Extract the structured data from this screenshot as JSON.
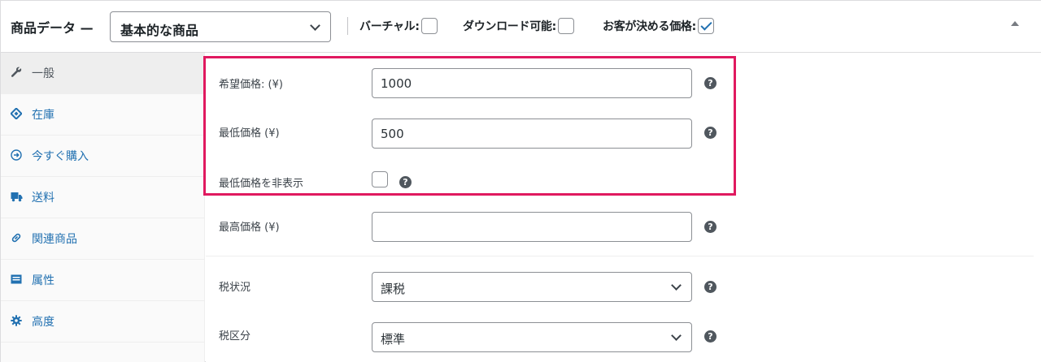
{
  "header": {
    "title": "商品データ —",
    "product_type": "基本的な商品",
    "options": [
      {
        "label": "バーチャル:",
        "checked": false
      },
      {
        "label": "ダウンロード可能:",
        "checked": false
      },
      {
        "label": "お客が決める価格:",
        "checked": true
      }
    ]
  },
  "sidebar": {
    "items": [
      {
        "label": "一般",
        "icon": "wrench-icon",
        "active": true
      },
      {
        "label": "在庫",
        "icon": "tag-icon",
        "active": false
      },
      {
        "label": "今すぐ購入",
        "icon": "arrow-circle-icon",
        "active": false
      },
      {
        "label": "送料",
        "icon": "truck-icon",
        "active": false
      },
      {
        "label": "関連商品",
        "icon": "link-icon",
        "active": false
      },
      {
        "label": "属性",
        "icon": "list-icon",
        "active": false
      },
      {
        "label": "高度",
        "icon": "gear-icon",
        "active": false
      }
    ]
  },
  "general": {
    "suggested_price_label": "希望価格: (¥)",
    "suggested_price_value": "1000",
    "min_price_label": "最低価格 (¥)",
    "min_price_value": "500",
    "hide_min_label": "最低価格を非表示",
    "hide_min_checked": false,
    "max_price_label": "最高価格 (¥)",
    "max_price_value": "",
    "tax_status_label": "税状況",
    "tax_status_value": "課税",
    "tax_class_label": "税区分",
    "tax_class_value": "標準",
    "help_glyph": "?"
  },
  "colors": {
    "highlight": "#e0195f",
    "link": "#2271b1",
    "checkbox_check": "#2271b1"
  }
}
